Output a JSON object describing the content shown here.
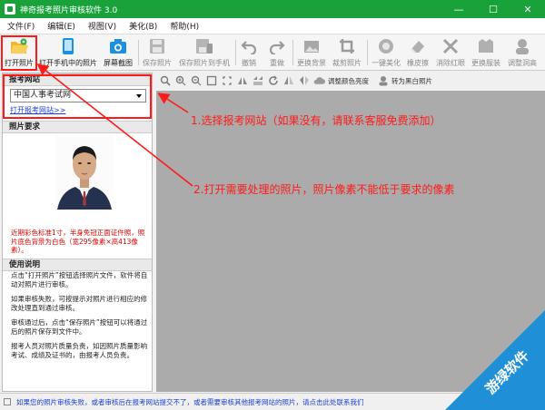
{
  "window": {
    "title": "神奇报考照片审核软件 3.0",
    "controls": [
      "—",
      "☐",
      "✕"
    ]
  },
  "menu": [
    "文件(F)",
    "编辑(E)",
    "视图(V)",
    "美化(B)",
    "帮助(H)"
  ],
  "toolbar": {
    "open_photo": "打开照片",
    "open_phone": "打开手机中的照片",
    "screenshot": "屏幕截图",
    "save_photo": "保存照片",
    "save_to_phone": "保存照片到手机",
    "undo": "撤销",
    "redo": "重做",
    "change_bg": "更换背景",
    "crop": "裁剪照片",
    "beautify": "一键美化",
    "eraser": "橡皮擦",
    "remove_redeye": "消除红眼",
    "change_clothes": "更换服装",
    "adjust_holes": "调整洞高"
  },
  "left_panel": {
    "site_heading": "报考网站",
    "site_selected": "中国人事考试网",
    "open_site_link": "打开报考网站>>",
    "photo_req_heading": "照片要求",
    "photo_req_note": "近期彩色标准1寸，半身免冠正面证件照，照片底色背景为白色（宽295像素×高413像素）。",
    "usage_heading": "使用说明",
    "usage_paragraphs": [
      "点击“打开照片”按钮选择照片文件，软件将自动对照片进行审核。",
      "如果审核失败，可按提示对照片进行相应的修改处理直到通过审核。",
      "审核通过后，点击“保存照片”按钮可以将通过后的照片保存到文件中。",
      "报考人员对照片质量负责，如因照片质量影响考试、成绩及证书的，由报考人员负责。"
    ]
  },
  "editor_toolbar": {
    "adjust_color": "调整颜色亮度",
    "to_bw": "转为黑白照片"
  },
  "status": {
    "message": "如果您的照片审核失败，或者审核后在报考网站提交不了，或者需要审核其他报考网站的照片，请点击此处联系我们"
  },
  "annotations": {
    "step1": "1.选择报考网站（如果没有，请联系客服免费添加）",
    "step2": "2.打开需要处理的照片，照片像素不能低于要求的像素"
  },
  "watermark": {
    "text": "游绿软件"
  },
  "colors": {
    "titlebar": "#1aa23a",
    "annotation_red": "#ff1a1a",
    "canvas_gray": "#ababab",
    "link_blue": "#1e3fd6",
    "watermark_blue": "#1f8fd8"
  }
}
